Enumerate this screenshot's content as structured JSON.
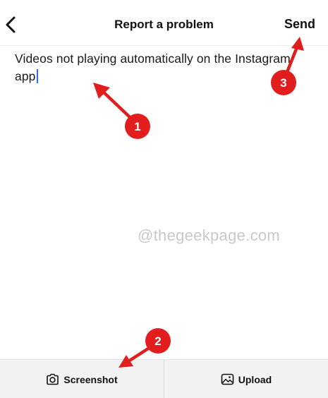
{
  "header": {
    "title": "Report a problem",
    "send_label": "Send",
    "back_icon": "chevron-left-icon"
  },
  "report": {
    "text": "Videos not playing automatically on the Instagram app"
  },
  "watermark": "@thegeekpage.com",
  "bottom_bar": {
    "screenshot_label": "Screenshot",
    "screenshot_icon": "camera-icon",
    "upload_label": "Upload",
    "upload_icon": "image-icon"
  },
  "annotations": [
    {
      "label": "1",
      "target": "report-text"
    },
    {
      "label": "2",
      "target": "screenshot-button"
    },
    {
      "label": "3",
      "target": "send-button"
    }
  ],
  "colors": {
    "annotation_red": "#e11d1d",
    "caret_blue": "#2f6bf5"
  }
}
